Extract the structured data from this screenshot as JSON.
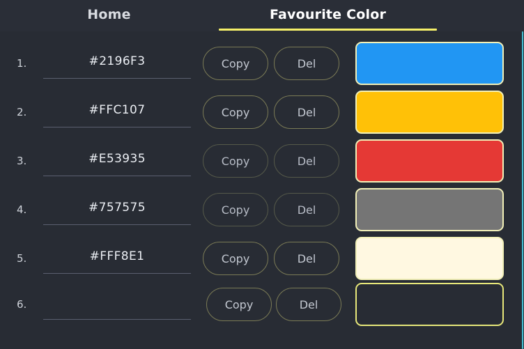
{
  "app": {
    "background": "#282c34",
    "accent": "#f6f069",
    "scrollbar_color": "#46c1d4"
  },
  "tabs": [
    {
      "label": "Home",
      "active": false,
      "name": "tab-home"
    },
    {
      "label": "Favourite Color",
      "active": true,
      "name": "tab-favourite-color"
    }
  ],
  "buttons": {
    "copy_label": "Copy",
    "delete_label": "Del"
  },
  "input": {
    "placeholder": ""
  },
  "rows": [
    {
      "index": "1.",
      "value": "#2196F3",
      "swatch": "#2196F3",
      "swatch_border": "#f2f0b8"
    },
    {
      "index": "2.",
      "value": "#FFC107",
      "swatch": "#FFC107",
      "swatch_border": "#f2f0b8"
    },
    {
      "index": "3.",
      "value": "#E53935",
      "swatch": "#E53935",
      "swatch_border": "#f2f0b8"
    },
    {
      "index": "4.",
      "value": "#757575",
      "swatch": "#757575",
      "swatch_border": "#f2f0b8"
    },
    {
      "index": "5.",
      "value": "#FFF8E1",
      "swatch": "#FFF8E1",
      "swatch_border": "#f2f0b8"
    },
    {
      "index": "6.",
      "value": "",
      "swatch": "transparent",
      "swatch_border": "#e8e87a"
    }
  ]
}
